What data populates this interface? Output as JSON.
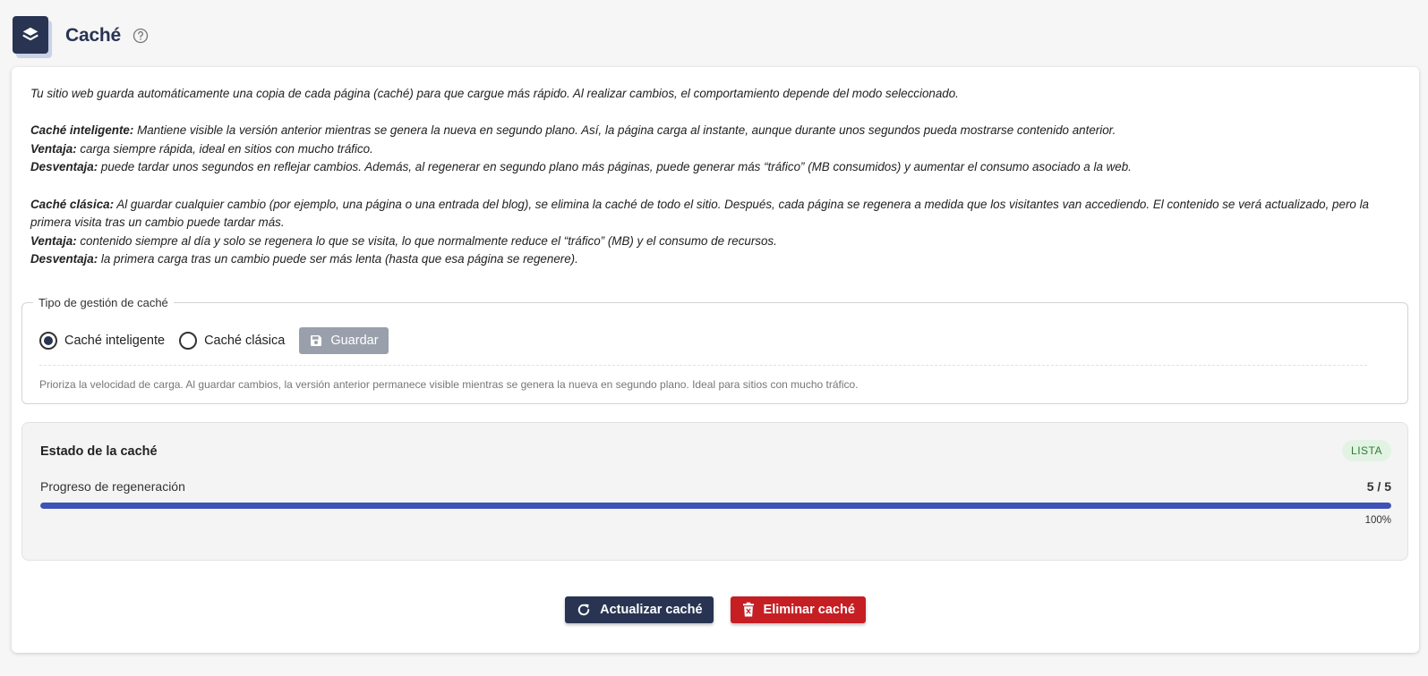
{
  "header": {
    "title": "Caché"
  },
  "intro": {
    "line1": "Tu sitio web guarda automáticamente una copia de cada página (caché) para que cargue más rápido. Al realizar cambios, el comportamiento depende del modo seleccionado.",
    "smart_label": "Caché inteligente:",
    "smart_text": " Mantiene visible la versión anterior mientras se genera la nueva en segundo plano. Así, la página carga al instante, aunque durante unos segundos pueda mostrarse contenido anterior.",
    "smart_pro_label": "Ventaja:",
    "smart_pro_text": " carga siempre rápida, ideal en sitios con mucho tráfico.",
    "smart_con_label": "Desventaja:",
    "smart_con_text": " puede tardar unos segundos en reflejar cambios. Además, al regenerar en segundo plano más páginas, puede generar más “tráfico” (MB consumidos) y aumentar el consumo asociado a la web.",
    "classic_label": "Caché clásica:",
    "classic_text": " Al guardar cualquier cambio (por ejemplo, una página o una entrada del blog), se elimina la caché de todo el sitio. Después, cada página se regenera a medida que los visitantes van accediendo. El contenido se verá actualizado, pero la primera visita tras un cambio puede tardar más.",
    "classic_pro_label": "Ventaja:",
    "classic_pro_text": " contenido siempre al día y solo se regenera lo que se visita, lo que normalmente reduce el “tráfico” (MB) y el consumo de recursos.",
    "classic_con_label": "Desventaja:",
    "classic_con_text": " la primera carga tras un cambio puede ser más lenta (hasta que esa página se regenere)."
  },
  "cache_type": {
    "legend": "Tipo de gestión de caché",
    "options": [
      {
        "label": "Caché inteligente",
        "checked": true
      },
      {
        "label": "Caché clásica",
        "checked": false
      }
    ],
    "save_label": "Guardar",
    "hint": "Prioriza la velocidad de carga. Al guardar cambios, la versión anterior permanece visible mientras se genera la nueva en segundo plano. Ideal para sitios con mucho tráfico."
  },
  "status": {
    "title": "Estado de la caché",
    "badge": "LISTA",
    "progress_label": "Progreso de regeneración",
    "progress_count": "5 / 5",
    "progress_percent_text": "100%",
    "progress_fraction": 1.0
  },
  "actions": {
    "refresh_label": "Actualizar caché",
    "delete_label": "Eliminar caché"
  },
  "colors": {
    "primary": "#283452",
    "danger": "#c51f24",
    "progress": "#3f52b5",
    "badge_bg": "#e2f3e3",
    "badge_text": "#2e7d32"
  },
  "icons": {
    "logo": "layers-icon",
    "help": "question-circle-icon",
    "save": "floppy-disk-icon",
    "refresh": "refresh-icon",
    "delete": "trash-icon"
  }
}
